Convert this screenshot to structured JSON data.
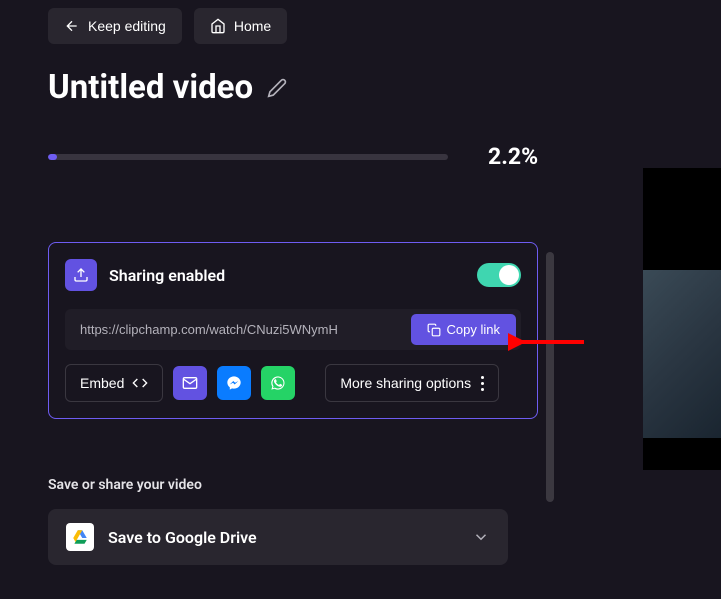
{
  "header": {
    "keep_editing": "Keep editing",
    "home": "Home"
  },
  "title": "Untitled video",
  "progress": {
    "percent": 2.2,
    "display": "2.2%"
  },
  "share": {
    "title": "Sharing enabled",
    "url": "https://clipchamp.com/watch/CNuzi5WNymH",
    "copy_label": "Copy link",
    "embed_label": "Embed",
    "more_label": "More sharing options"
  },
  "save": {
    "heading": "Save or share your video",
    "drive_label": "Save to Google Drive"
  },
  "colors": {
    "accent": "#6e5cf2",
    "toggle": "#3fd6b0",
    "arrow": "#ff0000"
  }
}
